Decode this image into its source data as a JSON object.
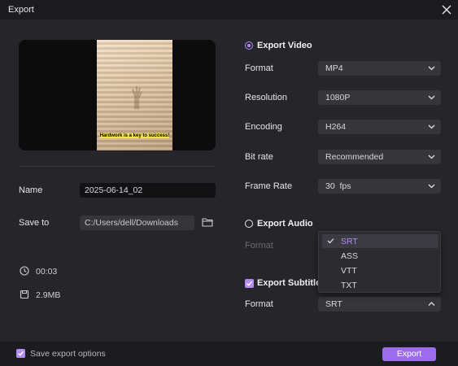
{
  "window": {
    "title": "Export"
  },
  "preview": {
    "caption": "Hardwork is a key to success!"
  },
  "name": {
    "label": "Name",
    "value": "2025-06-14_02"
  },
  "save_to": {
    "label": "Save to",
    "value": "C:/Users/dell/Downloads"
  },
  "info": {
    "duration": "00:03",
    "size": "2.9MB"
  },
  "export_video": {
    "title": "Export Video",
    "selected": true,
    "rows": [
      {
        "label": "Format",
        "value": "MP4"
      },
      {
        "label": "Resolution",
        "value": "1080P"
      },
      {
        "label": "Encoding",
        "value": "H264"
      },
      {
        "label": "Bit rate",
        "value": "Recommended"
      },
      {
        "label": "Frame Rate",
        "value": "30  fps"
      }
    ]
  },
  "export_audio": {
    "title": "Export Audio",
    "selected": false,
    "format_label": "Format"
  },
  "export_subtitles": {
    "title": "Export Subtitles",
    "checked": true,
    "format_label": "Format",
    "format_value": "SRT",
    "options": [
      "SRT",
      "ASS",
      "VTT",
      "TXT"
    ],
    "selected_option": "SRT"
  },
  "footer": {
    "save_options_label": "Save export options",
    "export_label": "Export"
  },
  "colors": {
    "accent": "#b58cf5",
    "button": "#9b6cf0",
    "panel": "#25262b",
    "field": "#35363c"
  }
}
